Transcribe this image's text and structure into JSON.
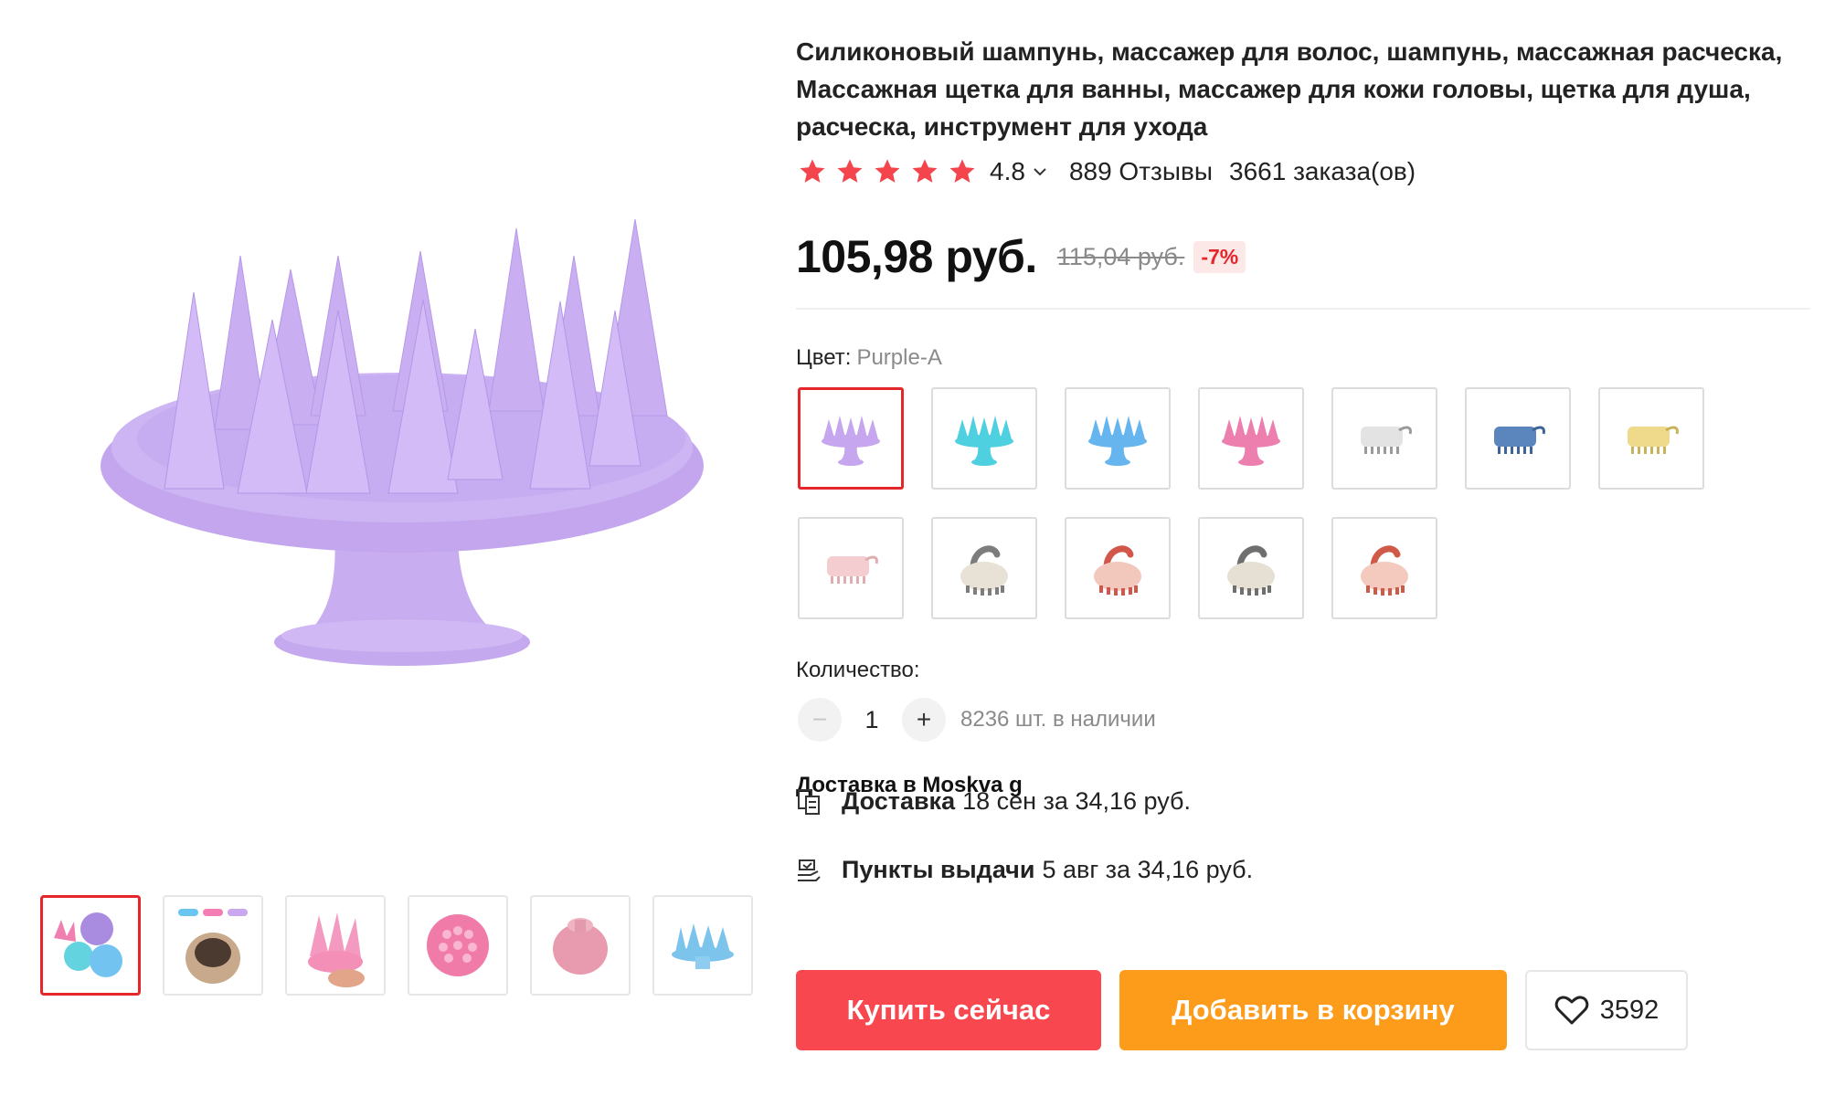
{
  "gallery": {
    "main_alt": "Purple silicone scalp massager brush",
    "thumbnails": [
      {
        "name": "thumb-1",
        "colors": [
          "#a98be0",
          "#64d3e0",
          "#f080b0"
        ]
      },
      {
        "name": "thumb-2",
        "colors": [
          "#6ac6f0",
          "#f27eb4",
          "#c9a8f0"
        ]
      },
      {
        "name": "thumb-3",
        "colors": [
          "#f49ac0"
        ]
      },
      {
        "name": "thumb-4",
        "colors": [
          "#f07aa8"
        ]
      },
      {
        "name": "thumb-5",
        "colors": [
          "#e89bae"
        ]
      },
      {
        "name": "thumb-6",
        "colors": [
          "#7cc4ec"
        ]
      }
    ]
  },
  "product": {
    "title": "Силиконовый шампунь, массажер для волос, шампунь, массажная расческа, Массажная щетка для ванны, массажер для кожи головы, щетка для душа, расческа, инструмент для ухода",
    "rating": "4.8",
    "reviews": "889 Отзывы",
    "orders": "3661 заказа(ов)",
    "price": "105,98 руб.",
    "old_price": "115,04 руб.",
    "discount": "-7%"
  },
  "color": {
    "label": "Цвет:",
    "selected": "Purple-A",
    "swatches": [
      {
        "name": "purple-a",
        "type": "brush",
        "color": "#c6a6ee",
        "accent": "#c6a6ee"
      },
      {
        "name": "cyan-a",
        "type": "brush",
        "color": "#4fd0e0",
        "accent": "#4fd0e0"
      },
      {
        "name": "blue-a",
        "type": "brush",
        "color": "#66b5ee",
        "accent": "#66b5ee"
      },
      {
        "name": "pink-a",
        "type": "brush",
        "color": "#ec7fae",
        "accent": "#ec7fae"
      },
      {
        "name": "white-b",
        "type": "handle",
        "color": "#e3e3e3",
        "accent": "#9a9a9a"
      },
      {
        "name": "blue-b",
        "type": "handle",
        "color": "#5a86bd",
        "accent": "#3d6496"
      },
      {
        "name": "yellow-b",
        "type": "handle",
        "color": "#efd98a",
        "accent": "#c9b35a"
      },
      {
        "name": "pink-b",
        "type": "handle",
        "color": "#f3cdd0",
        "accent": "#e0aeb2"
      },
      {
        "name": "grey-c",
        "type": "round",
        "color": "#e8e2d6",
        "accent": "#7d7d7d"
      },
      {
        "name": "red-c",
        "type": "round",
        "color": "#f2c8bd",
        "accent": "#d2564a"
      },
      {
        "name": "grey-d",
        "type": "round",
        "color": "#e5e0d3",
        "accent": "#6f6f6f"
      },
      {
        "name": "red-d",
        "type": "round",
        "color": "#f3cabd",
        "accent": "#cf5a48"
      }
    ]
  },
  "quantity": {
    "label": "Количество:",
    "minus": "−",
    "plus": "+",
    "value": "1",
    "stock": "8236 шт. в наличии"
  },
  "delivery": {
    "title": "Доставка в Moskva g",
    "courier_label": "Доставка",
    "courier_text": "18 сен за 34,16 руб.",
    "pickup_label": "Пункты выдачи",
    "pickup_text": "5 авг за 34,16 руб."
  },
  "actions": {
    "buy_now": "Купить сейчас",
    "add_to_cart": "Добавить в корзину",
    "wishlist_count": "3592"
  },
  "colors": {
    "accent_red": "#f8474e",
    "accent_orange": "#fd9b1a",
    "star": "#f4444c",
    "selected_border": "#e5262b"
  }
}
